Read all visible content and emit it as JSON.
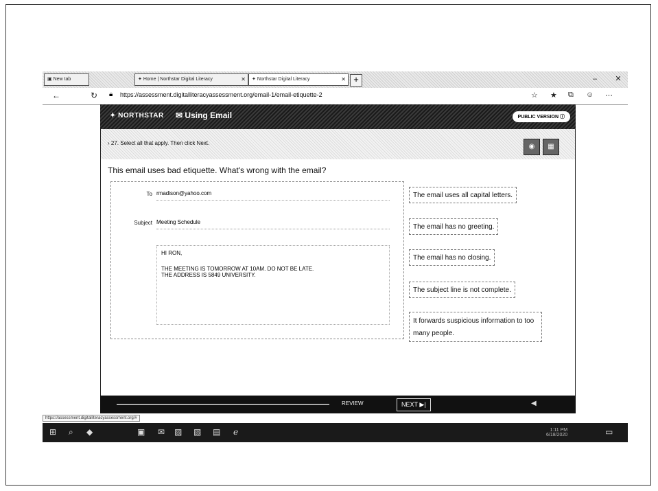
{
  "browser": {
    "tabs": [
      {
        "label": "New tab"
      },
      {
        "label": "Home | Northstar Digital Literacy"
      },
      {
        "label": "Northstar Digital Literacy"
      }
    ],
    "url": "https://assessment.digitalliteracyassessment.org/email-1/email-etiquette-2",
    "status_url": "https://assessment.digitalliteracyassessment.org/#"
  },
  "header": {
    "brand": "NORTHSTAR",
    "module": "Using Email",
    "public_version": "PUBLIC VERSION"
  },
  "question": {
    "instruction": "27. Select all that apply. Then click Next.",
    "prompt": "This email uses bad etiquette. What's wrong with the email?"
  },
  "email": {
    "to_label": "To",
    "to_value": "rmadison@yahoo.com",
    "subject_label": "Subject",
    "subject_value": "Meeting Schedule",
    "greeting": "HI RON,",
    "line1": "THE MEETING IS TOMORROW AT 10AM. DO NOT BE LATE.",
    "line2": "THE ADDRESS IS 5849 UNIVERSITY."
  },
  "options": [
    "The email uses all capital letters.",
    "The email has no greeting.",
    "The email has no closing.",
    "The subject line is not complete.",
    "It forwards suspicious information to too many people."
  ],
  "footer": {
    "review_label": "REVIEW",
    "next_label": "NEXT"
  },
  "taskbar": {
    "time": "1:11 PM",
    "date": "6/18/2020"
  }
}
